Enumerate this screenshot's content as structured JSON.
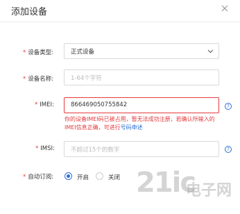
{
  "dialog": {
    "title": "添加设备",
    "close_icon": "close-icon"
  },
  "form": {
    "required_mark": "*",
    "device_type": {
      "label": "设备类型:",
      "value": "正式设备",
      "icon": "chevron-down-icon"
    },
    "device_name": {
      "label": "设备名称:",
      "placeholder": "1-64个字符"
    },
    "imei": {
      "label": "IMEI:",
      "value": "866469050755842",
      "error_text": "你的设备IMEI码已被占用，暂无法成功注册，若确认所输入的IMEI信息正确，可进行",
      "error_link": "号码申述",
      "help_icon": "question-circle-icon",
      "help_symbol": "?"
    },
    "imsi": {
      "label": "IMSI:",
      "placeholder": "不超过15个的数字",
      "help_icon": "question-circle-icon",
      "help_symbol": "?"
    },
    "auto_subscribe": {
      "label": "自动订阅:",
      "options": [
        {
          "label": "开启",
          "checked": true
        },
        {
          "label": "关闭",
          "checked": false
        }
      ]
    }
  },
  "watermark": {
    "logo_text": "21ic",
    "brand_text": "电子网"
  },
  "colors": {
    "required": "#e4393c",
    "error": "#e4393c",
    "accent": "#2a6fd6",
    "border": "#d9d9d9"
  }
}
